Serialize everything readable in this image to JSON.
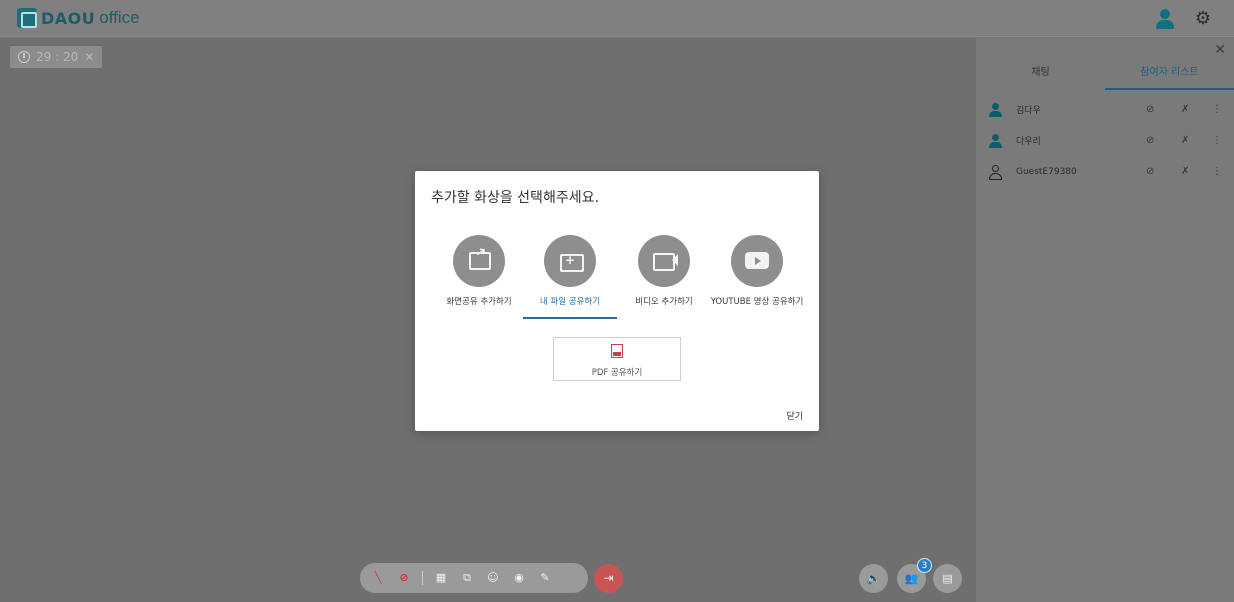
{
  "header": {
    "logo_bold": "DAOU",
    "logo_light": "office"
  },
  "stage": {
    "timer": "29 : 20"
  },
  "panel": {
    "tabs": [
      "채팅",
      "참여자 리스트"
    ],
    "active_tab": 1,
    "participants": [
      {
        "name": "김다우",
        "avatar": "solid"
      },
      {
        "name": "다우리",
        "avatar": "solid"
      },
      {
        "name": "GuestE79380",
        "avatar": "outline"
      }
    ]
  },
  "toolbar": {
    "participant_badge": "3"
  },
  "modal": {
    "title": "추가할 화상을 선택해주세요.",
    "options": [
      {
        "label": "화면공유 추가하기",
        "icon": "share-screen-icon"
      },
      {
        "label": "내 파일 공유하기",
        "icon": "file-share-icon",
        "active": true
      },
      {
        "label": "비디오 추가하기",
        "icon": "video-add-icon"
      },
      {
        "label": "YOUTUBE 영상 공유하기",
        "icon": "youtube-icon"
      }
    ],
    "pdf_button": "PDF 공유하기",
    "close": "닫기"
  }
}
